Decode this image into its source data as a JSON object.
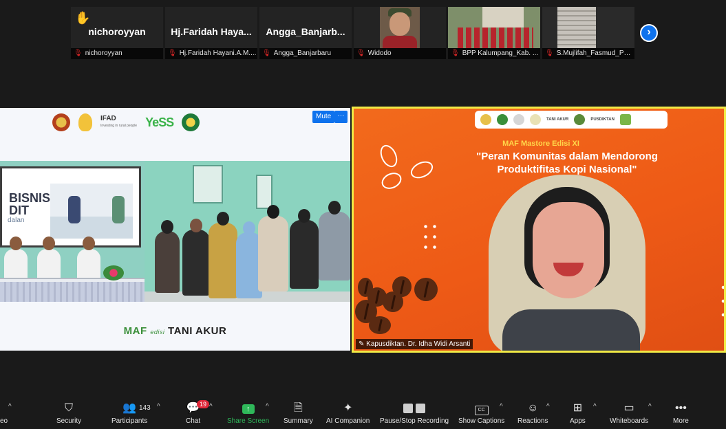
{
  "participants": [
    {
      "display": "nichoroyyan",
      "label": "nichoroyyan",
      "raised_hand": true,
      "video": false
    },
    {
      "display": "Hj.Faridah Haya...",
      "label": "Hj.Faridah Hayani.A.M....",
      "video": false
    },
    {
      "display": "Angga_Banjarb...",
      "label": "Angga_Banjarbaru",
      "video": false
    },
    {
      "display": "",
      "label": "Widodo",
      "video": true
    },
    {
      "display": "",
      "label": "BPP Kalumpang_Kab. ...",
      "video": true
    },
    {
      "display": "",
      "label": "S.Mujlifah_Fasmud_Pel...",
      "video": true
    }
  ],
  "left_video": {
    "logos": [
      "IFAD",
      "Investing in rural people",
      "YeSS"
    ],
    "banner_text": "BISNIS\nDIT",
    "banner_sub": "dalan",
    "caption_maf": "MAF",
    "caption_edisi": "edisi",
    "caption_name": "TANI AKUR",
    "mute_label": "Mute",
    "more_label": "···"
  },
  "right_video": {
    "logo_texts": [
      "TANI AKUR",
      "PUSDIKTAN"
    ],
    "title": "MAF Mastore Edisi XI",
    "quote": "\"Peran Komunitas dalam Mendorong Produktifitas Kopi Nasional\"",
    "speaker": "Kapusdiktan. Dr. Idha Widi Arsanti",
    "border_color": "#f1ea45",
    "bg_color": "#f26a1c"
  },
  "toolbar": {
    "video_label": "eo",
    "security": "Security",
    "participants": "Participants",
    "participant_count": "143",
    "chat": "Chat",
    "chat_badge": "19",
    "share_screen": "Share Screen",
    "summary": "Summary",
    "ai_companion": "AI Companion",
    "pause_stop": "Pause/Stop Recording",
    "show_captions": "Show Captions",
    "captions_glyph": "CC",
    "reactions": "Reactions",
    "apps": "Apps",
    "whiteboards": "Whiteboards",
    "more": "More"
  },
  "colors": {
    "accent_blue": "#0e72ed",
    "share_green": "#2fb85a",
    "muted_red": "#e02828"
  }
}
